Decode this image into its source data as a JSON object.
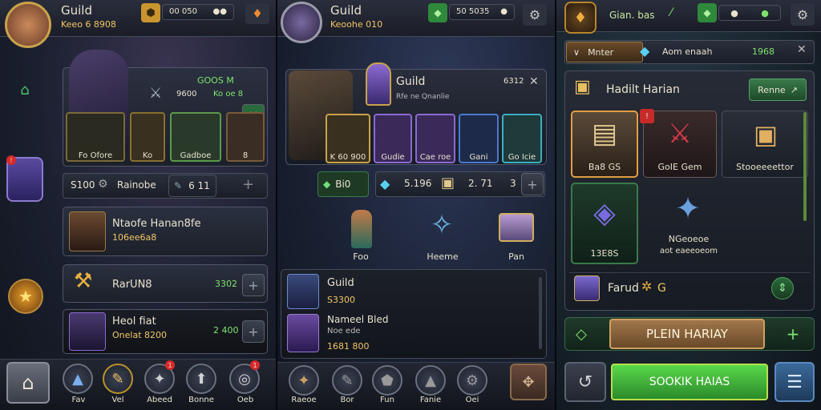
{
  "panel1": {
    "title": "Guild",
    "subtitle": "Keeo 6 8908",
    "currency_value": "00 050",
    "char_stats": "GOOS M",
    "char_value": "9600",
    "char_value2": "Ko oe 8",
    "tile_labels": [
      "Fo Ofore",
      "Ko",
      "Gadboe",
      "8"
    ],
    "filter_left": "S100",
    "filter_label": "Rainobe",
    "filter_right": "6 11",
    "member_name": "Ntaofe Hanan8fe",
    "member_sub": "106ee6a8",
    "reward1_label": "RarUN8",
    "reward1_value": "3302",
    "reward2_title": "Heol fiat",
    "reward2_sub": "Onelat 8200",
    "reward2_value": "2 400",
    "nav": [
      "Fav",
      "Vel",
      "Abeed",
      "Bonne",
      "Oeb"
    ]
  },
  "panel2": {
    "title": "Guild",
    "subtitle": "Keoohe 010",
    "currency_value": "50 5035",
    "dialog_title": "Guild",
    "dialog_sub": "Rfe ne Qnanlie",
    "dialog_value": "6312",
    "tile_labels": [
      "K 60 900",
      "Gudie",
      "Cae roe",
      "Gani",
      "Go Icie"
    ],
    "res1": "Bi0",
    "res2": "5.196",
    "res3": "2. 71",
    "res4": "3",
    "items": [
      "Foo",
      "Heeme",
      "Pan"
    ],
    "list": [
      {
        "name": "Guild",
        "value": "S3300"
      },
      {
        "name": "Nameel Bled",
        "sub": "Noe ede",
        "value": "1681 800"
      }
    ],
    "nav": [
      "Raeoe",
      "Bor",
      "Fun",
      "Fanie",
      "Oei"
    ]
  },
  "panel3": {
    "title": "Gian. bas",
    "tab1": "Mnter",
    "tab2": "Aom enaah",
    "tab2_value": "1968",
    "section_title": "Hadilt Harian",
    "section_button": "Renne",
    "cards": [
      "Ba8 GS",
      "GoIE Gem",
      "Stooeeeettor"
    ],
    "big_card_value": "13E8S",
    "big_card_title": "NGeoeoe",
    "big_card_sub": "aot eaeeoeom",
    "row_label": "Farud",
    "row_value": "G",
    "banner": "PLEIN HARIAY",
    "action": "SOOKIK HAIAS"
  },
  "colors": {
    "gold": "#f0c766",
    "green": "#7ee36e",
    "accent_green": "#3cd04a",
    "panel_dark": "#1a1e28"
  }
}
